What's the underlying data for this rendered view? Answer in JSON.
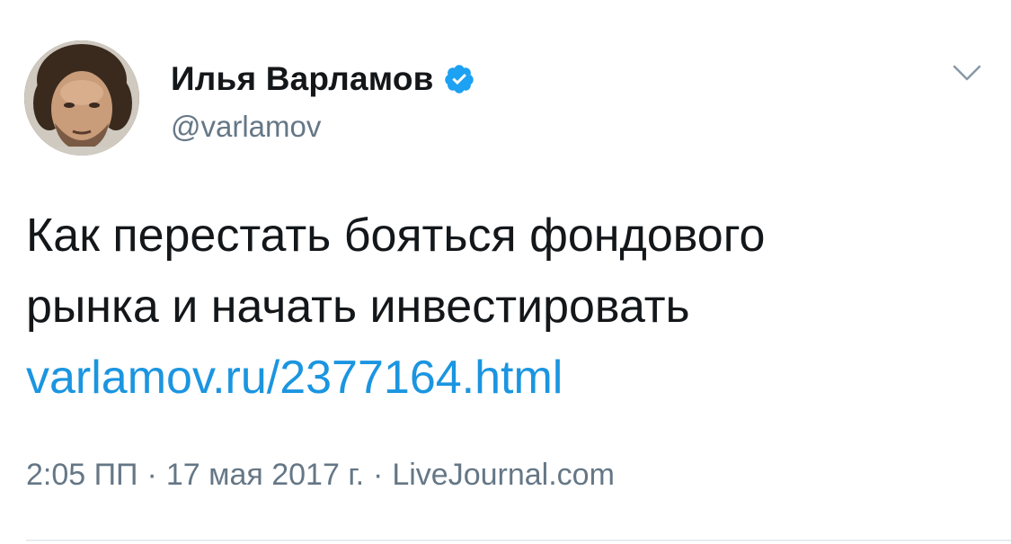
{
  "tweet": {
    "author": {
      "name": "Илья Варламов",
      "handle": "@varlamov",
      "verified": true
    },
    "text": {
      "line1": "Как перестать бояться фондового",
      "line2": "рынка и начать инвестировать",
      "link": "varlamov.ru/2377164.html"
    },
    "meta": {
      "time": "2:05 ПП",
      "separator": "·",
      "date": "17 мая 2017 г.",
      "source": "LiveJournal.com"
    }
  },
  "icons": {
    "verified": "verified-badge-icon",
    "caret": "chevron-down-icon"
  },
  "colors": {
    "link": "#1b95e0",
    "verified": "#1da1f2",
    "secondary_text": "#657786",
    "primary_text": "#14171a",
    "divider": "#e6ecf0"
  }
}
